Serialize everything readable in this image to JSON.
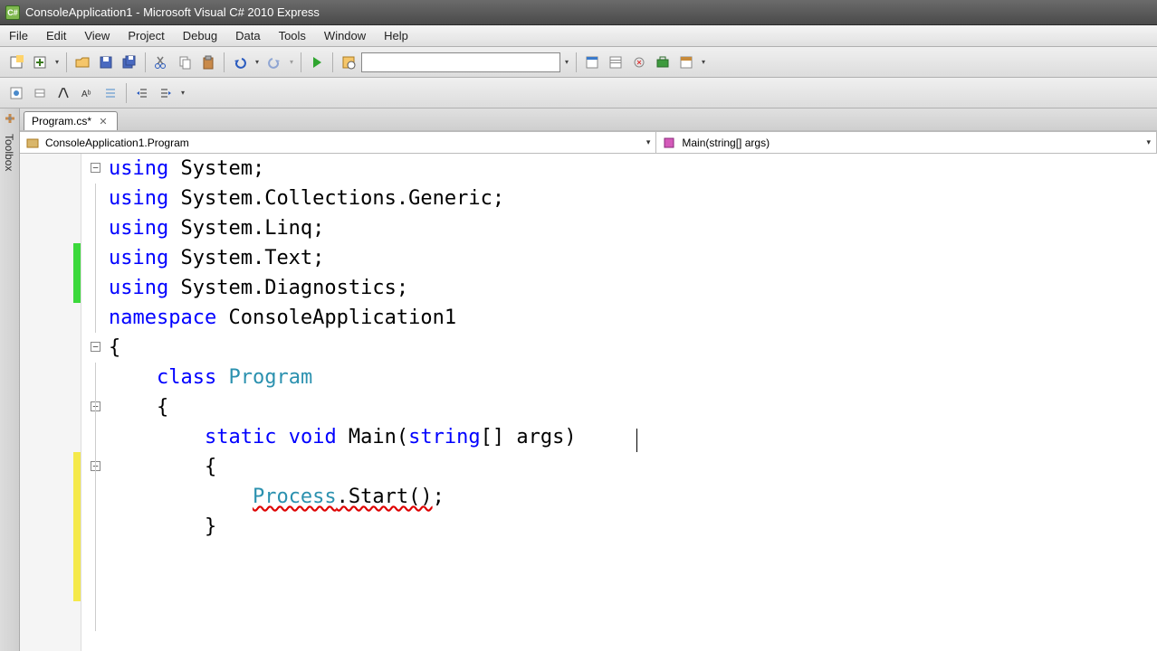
{
  "window": {
    "title": "ConsoleApplication1 - Microsoft Visual C# 2010 Express",
    "icon_label": "C#"
  },
  "menu": {
    "file": "File",
    "edit": "Edit",
    "view": "View",
    "project": "Project",
    "debug": "Debug",
    "data": "Data",
    "tools": "Tools",
    "window": "Window",
    "help": "Help"
  },
  "toolbox": {
    "label": "Toolbox"
  },
  "tabs": {
    "active": "Program.cs*"
  },
  "nav": {
    "class": "ConsoleApplication1.Program",
    "member": "Main(string[] args)"
  },
  "code": {
    "lines": [
      {
        "tokens": [
          [
            "kw",
            "using"
          ],
          [
            "txt",
            " System;"
          ]
        ]
      },
      {
        "tokens": [
          [
            "kw",
            "using"
          ],
          [
            "txt",
            " System.Collections.Generic;"
          ]
        ]
      },
      {
        "tokens": [
          [
            "kw",
            "using"
          ],
          [
            "txt",
            " System.Linq;"
          ]
        ]
      },
      {
        "tokens": [
          [
            "kw",
            "using"
          ],
          [
            "txt",
            " System.Text;"
          ]
        ],
        "change": "green"
      },
      {
        "tokens": [
          [
            "kw",
            "using"
          ],
          [
            "txt",
            " System.Diagnostics;"
          ]
        ],
        "change": "green"
      },
      {
        "tokens": [
          [
            "txt",
            ""
          ]
        ]
      },
      {
        "tokens": [
          [
            "kw",
            "namespace"
          ],
          [
            "txt",
            " ConsoleApplication1"
          ]
        ]
      },
      {
        "tokens": [
          [
            "txt",
            "{"
          ]
        ]
      },
      {
        "tokens": [
          [
            "txt",
            "    "
          ],
          [
            "kw",
            "class"
          ],
          [
            "txt",
            " "
          ],
          [
            "type",
            "Program"
          ]
        ]
      },
      {
        "tokens": [
          [
            "txt",
            "    {"
          ]
        ]
      },
      {
        "tokens": [
          [
            "txt",
            "        "
          ],
          [
            "kw",
            "static"
          ],
          [
            "txt",
            " "
          ],
          [
            "kw",
            "void"
          ],
          [
            "txt",
            " Main("
          ],
          [
            "kw",
            "string"
          ],
          [
            "txt",
            "[] args)"
          ]
        ],
        "change": "yellow",
        "cursor_after": true
      },
      {
        "tokens": [
          [
            "txt",
            "        {"
          ]
        ],
        "change": "yellow"
      },
      {
        "tokens": [
          [
            "txt",
            ""
          ]
        ],
        "change": "yellow"
      },
      {
        "tokens": [
          [
            "txt",
            "            "
          ],
          [
            "type squiggle",
            "Process"
          ],
          [
            "txt squiggle",
            ".Start()"
          ],
          [
            "txt",
            ";"
          ]
        ],
        "change": "yellow"
      },
      {
        "tokens": [
          [
            "txt",
            ""
          ]
        ],
        "change": "yellow"
      },
      {
        "tokens": [
          [
            "txt",
            "        }"
          ]
        ]
      }
    ],
    "outline_boxes": [
      0,
      6,
      8,
      10
    ],
    "outline_lines": [
      [
        1,
        5
      ],
      [
        7,
        15
      ],
      [
        9,
        15
      ],
      [
        11,
        15
      ]
    ]
  },
  "icons": {
    "drop": "▾"
  }
}
